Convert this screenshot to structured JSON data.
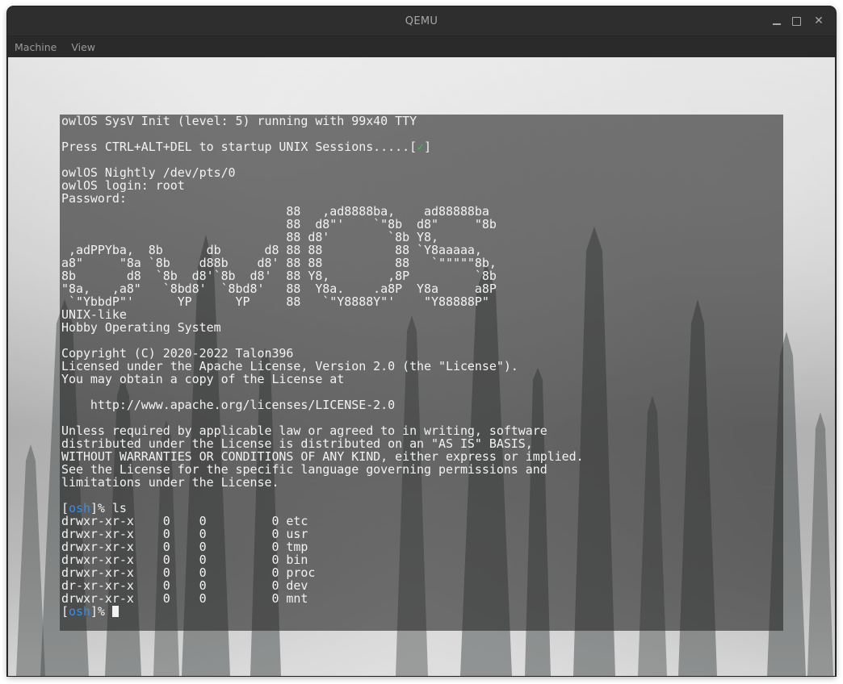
{
  "window": {
    "title": "QEMU",
    "close_glyph": "✕"
  },
  "menubar": {
    "items": [
      "Machine",
      "View"
    ]
  },
  "terminal": {
    "init_line": "owlOS SysV Init (level: 5) running with 99x40 TTY",
    "press_prefix": "Press CTRL+ALT+DEL to startup UNIX Sessions.....[",
    "press_mark": "✓",
    "press_suffix": "]",
    "nightly_line": "owlOS Nightly /dev/pts/0",
    "login_line": "owlOS login: root",
    "password_line": "Password:",
    "ascii_art": [
      "                               88   ,ad8888ba,    ad88888ba",
      "                               88  d8\"'    `\"8b  d8\"     \"8b",
      "                               88 d8'        `8b Y8,",
      " ,adPPYba,  8b      db      d8 88 88          88 `Y8aaaaa,",
      "a8\"     \"8a `8b    d88b    d8' 88 88          88   `\"\"\"\"\"8b,",
      "8b       d8  `8b  d8'`8b  d8'  88 Y8,        ,8P         `8b",
      "\"8a,   ,a8\"   `8bd8'  `8bd8'   88  Y8a.    .a8P  Y8a     a8P",
      " `\"YbbdP\"'      YP      YP     88   `\"Y8888Y\"'    \"Y88888P\""
    ],
    "unix_like": "UNIX-like",
    "hobby": "Hobby Operating System",
    "copyright": "Copyright (C) 2020-2022 Talon396",
    "license_lines": [
      "Licensed under the Apache License, Version 2.0 (the \"License\").",
      "You may obtain a copy of the License at"
    ],
    "license_url": "    http://www.apache.org/licenses/LICENSE-2.0",
    "disclaimer_lines": [
      "Unless required by applicable law or agreed to in writing, software",
      "distributed under the License is distributed on an \"AS IS\" BASIS,",
      "WITHOUT WARRANTIES OR CONDITIONS OF ANY KIND, either express or implied.",
      "See the License for the specific language governing permissions and",
      "limitations under the License."
    ],
    "prompt_name": "osh",
    "prompt_suffix": "]% ",
    "command": "ls",
    "ls_rows": [
      "drwxr-xr-x    0    0         0 etc",
      "drwxr-xr-x    0    0         0 usr",
      "drwxr-xr-x    0    0         0 tmp",
      "drwxr-xr-x    0    0         0 bin",
      "drwxr-xr-x    0    0         0 proc",
      "dr-xr-xr-x    0    0         0 dev",
      "drwxr-xr-x    0    0         0 mnt"
    ]
  }
}
